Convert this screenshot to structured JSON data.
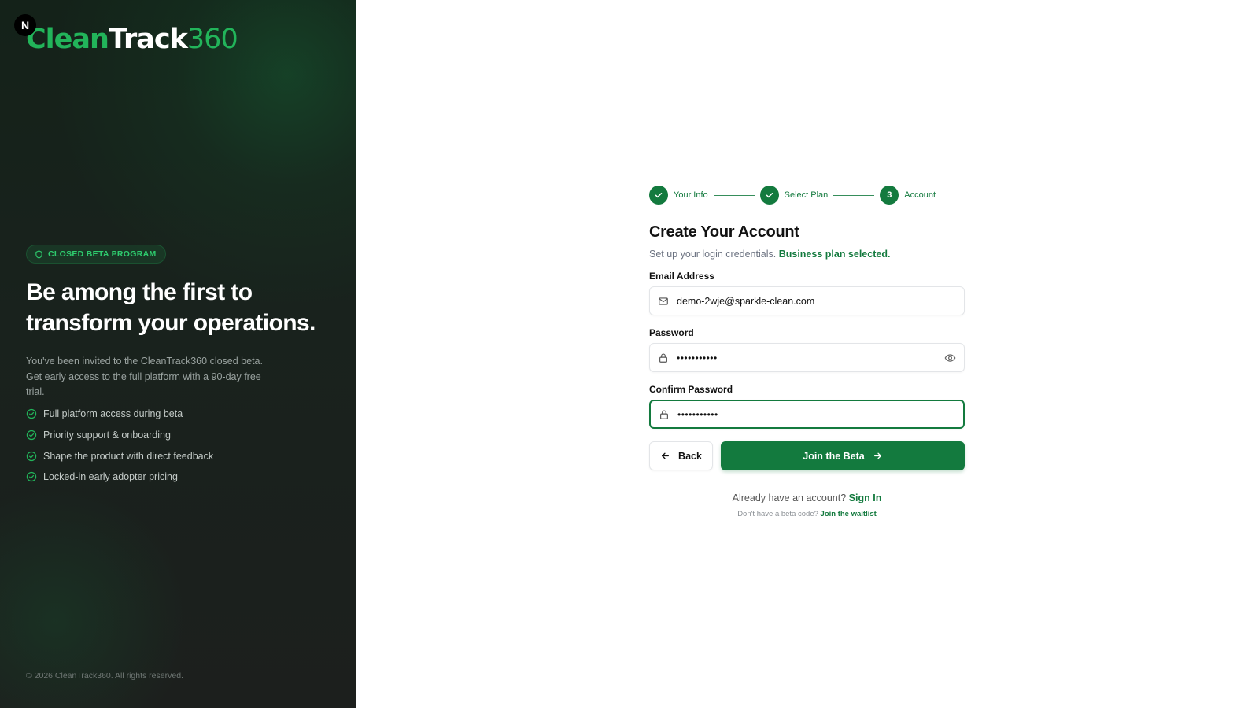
{
  "brand": {
    "badge_letter": "N",
    "logo_part1": "Clean",
    "logo_part2": "Track",
    "logo_part3": "360"
  },
  "hero": {
    "badge": "CLOSED BETA PROGRAM",
    "title": "Be among the first to transform your operations.",
    "description": "You've been invited to the CleanTrack360 closed beta. Get early access to the full platform with a 90-day free trial.",
    "features": [
      "Full platform access during beta",
      "Priority support & onboarding",
      "Shape the product with direct feedback",
      "Locked-in early adopter pricing"
    ],
    "copyright": "© 2026 CleanTrack360. All rights reserved."
  },
  "stepper": {
    "steps": [
      {
        "label": "Your Info",
        "state": "completed"
      },
      {
        "label": "Select Plan",
        "state": "completed"
      },
      {
        "label": "Account",
        "state": "current",
        "number": "3"
      }
    ]
  },
  "form": {
    "title": "Create Your Account",
    "subtitle": "Set up your login credentials.",
    "plan_note": "Business plan selected.",
    "email": {
      "label": "Email Address",
      "value": "demo-2wje@sparkle-clean.com"
    },
    "password": {
      "label": "Password",
      "value": "•••••••••••"
    },
    "confirm_password": {
      "label": "Confirm Password",
      "value": "•••••••••••"
    },
    "back_label": "Back",
    "submit_label": "Join the Beta",
    "signin_prompt": "Already have an account?",
    "signin_link": "Sign In",
    "waitlist_prompt": "Don't have a beta code?",
    "waitlist_link": "Join the waitlist"
  },
  "colors": {
    "accent": "#137a3e",
    "logo_green": "#22b45a",
    "panel_dark": "#1a211d"
  }
}
